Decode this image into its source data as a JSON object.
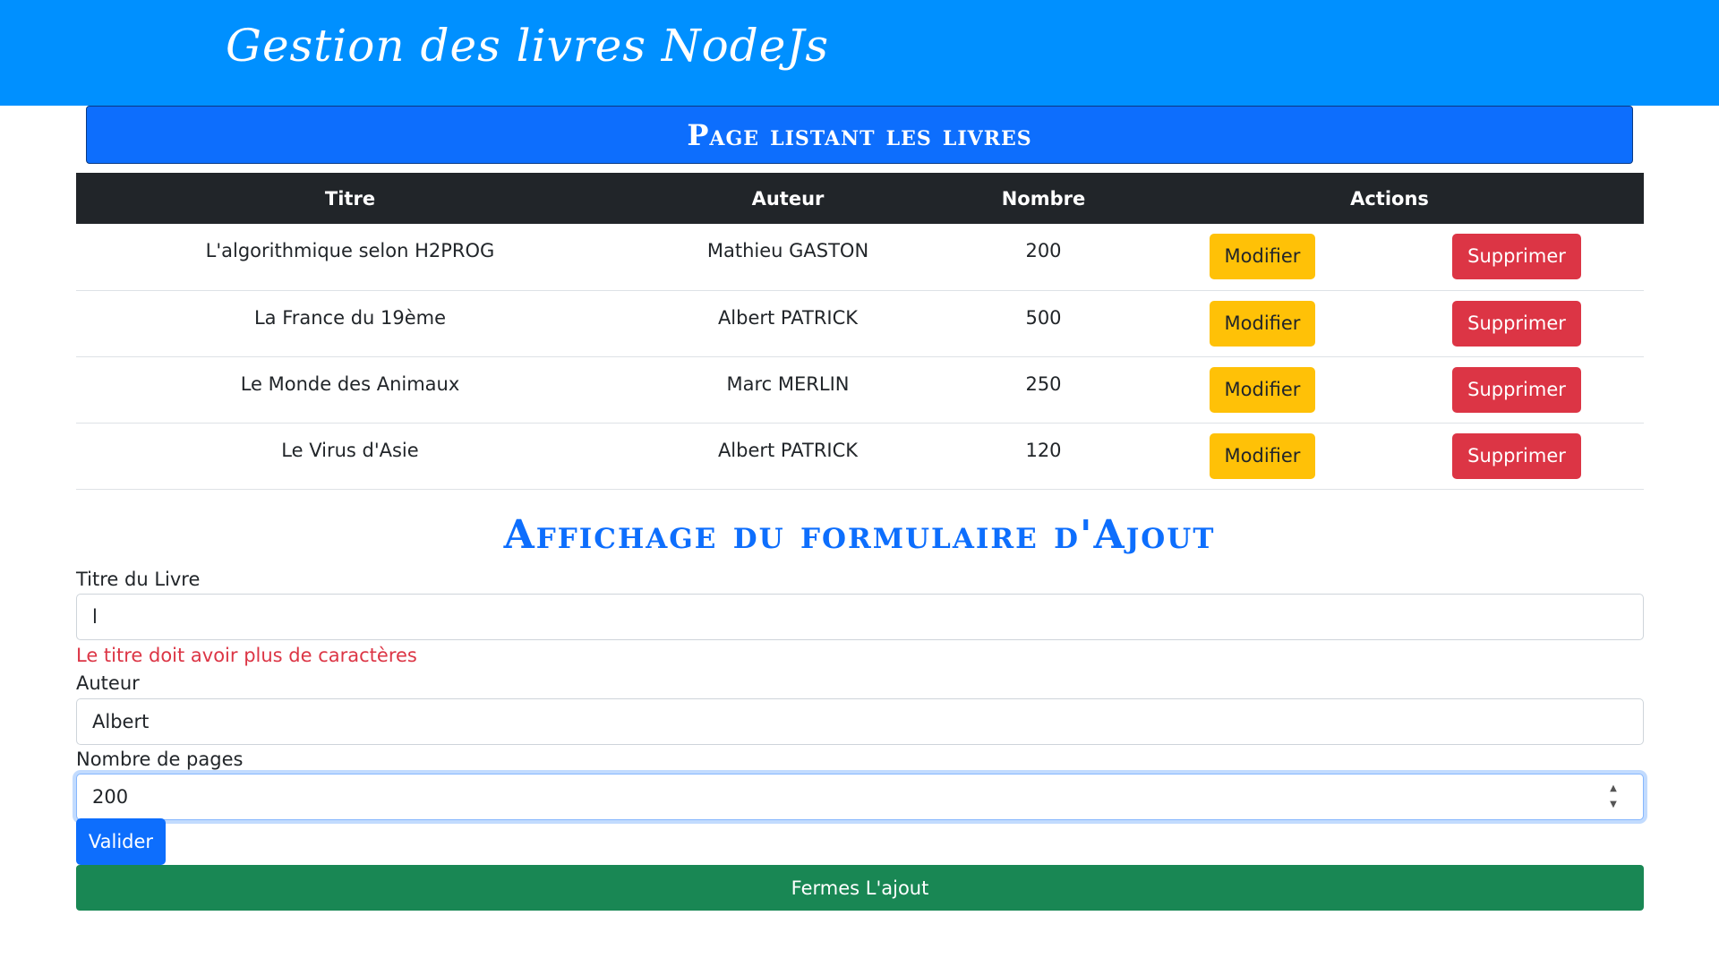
{
  "header": {
    "brand": "Gestion des livres NodeJs"
  },
  "banner": {
    "title": "Page listant les livres"
  },
  "table": {
    "columns": [
      "Titre",
      "Auteur",
      "Nombre",
      "Actions"
    ],
    "rows": [
      {
        "titre": "L'algorithmique selon H2PROG",
        "auteur": "Mathieu GASTON",
        "nombre": "200"
      },
      {
        "titre": "La France du 19ème",
        "auteur": "Albert PATRICK",
        "nombre": "500"
      },
      {
        "titre": "Le Monde des Animaux",
        "auteur": "Marc MERLIN",
        "nombre": "250"
      },
      {
        "titre": "Le Virus d'Asie",
        "auteur": "Albert PATRICK",
        "nombre": "120"
      }
    ],
    "modify_label": "Modifier",
    "delete_label": "Supprimer"
  },
  "form": {
    "title": "Affichage du formulaire d'Ajout",
    "titre_label": "Titre du Livre",
    "titre_value": "l",
    "titre_error": "Le titre doit avoir plus de caractères",
    "auteur_label": "Auteur",
    "auteur_value": "Albert",
    "pages_label": "Nombre de pages",
    "pages_value": "200",
    "submit_label": "Valider",
    "close_label": "Fermes L'ajout"
  },
  "colors": {
    "header_bg": "#0090ff",
    "banner_bg": "#0d6efd",
    "table_head_bg": "#212529",
    "modify": "#ffc107",
    "delete": "#dc3545",
    "error": "#dc3545",
    "submit": "#0d6efd",
    "close": "#198754"
  }
}
